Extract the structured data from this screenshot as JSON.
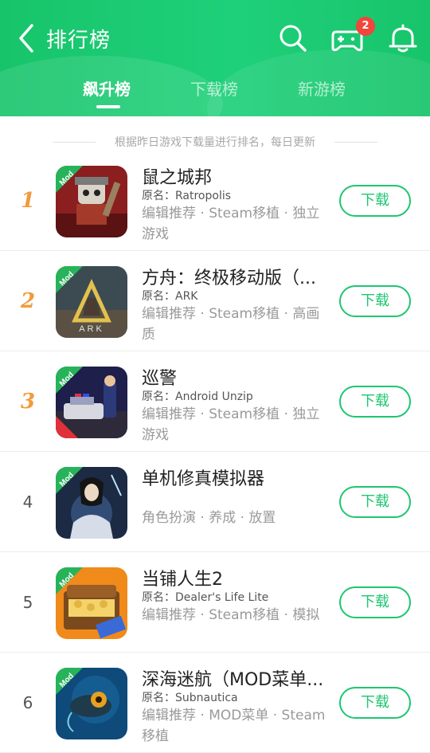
{
  "header": {
    "title": "排行榜",
    "badge_count": "2",
    "accent_color": "#1fd07a",
    "icons": [
      "back-arrow-icon",
      "search-icon",
      "gamepad-icon",
      "bell-icon"
    ]
  },
  "tabs": [
    {
      "label": "飙升榜",
      "active": true
    },
    {
      "label": "下载榜",
      "active": false
    },
    {
      "label": "新游榜",
      "active": false
    }
  ],
  "notice": "根据昨日游戏下载量进行排名，每日更新",
  "download_label": "下载",
  "mod_label": "Mod",
  "games": [
    {
      "rank": "1",
      "name": "鼠之城邦",
      "original": "原名：Ratropolis",
      "tags": "编辑推荐 · Steam移植 · 独立游戏"
    },
    {
      "rank": "2",
      "name": "方舟：终极移动版（...",
      "original": "原名：ARK",
      "tags": "编辑推荐 · Steam移植 · 高画质"
    },
    {
      "rank": "3",
      "name": "巡警",
      "original": "原名：Android Unzip",
      "tags": "编辑推荐 · Steam移植 · 独立游戏"
    },
    {
      "rank": "4",
      "name": "单机修真模拟器",
      "original": "",
      "tags": "角色扮演 · 养成 · 放置"
    },
    {
      "rank": "5",
      "name": "当铺人生2",
      "original": "原名：Dealer's Life Lite",
      "tags": "编辑推荐 · Steam移植 · 模拟"
    },
    {
      "rank": "6",
      "name": "深海迷航（MOD菜单...",
      "original": "原名：Subnautica",
      "tags": "编辑推荐 · MOD菜单 · Steam移植"
    }
  ]
}
